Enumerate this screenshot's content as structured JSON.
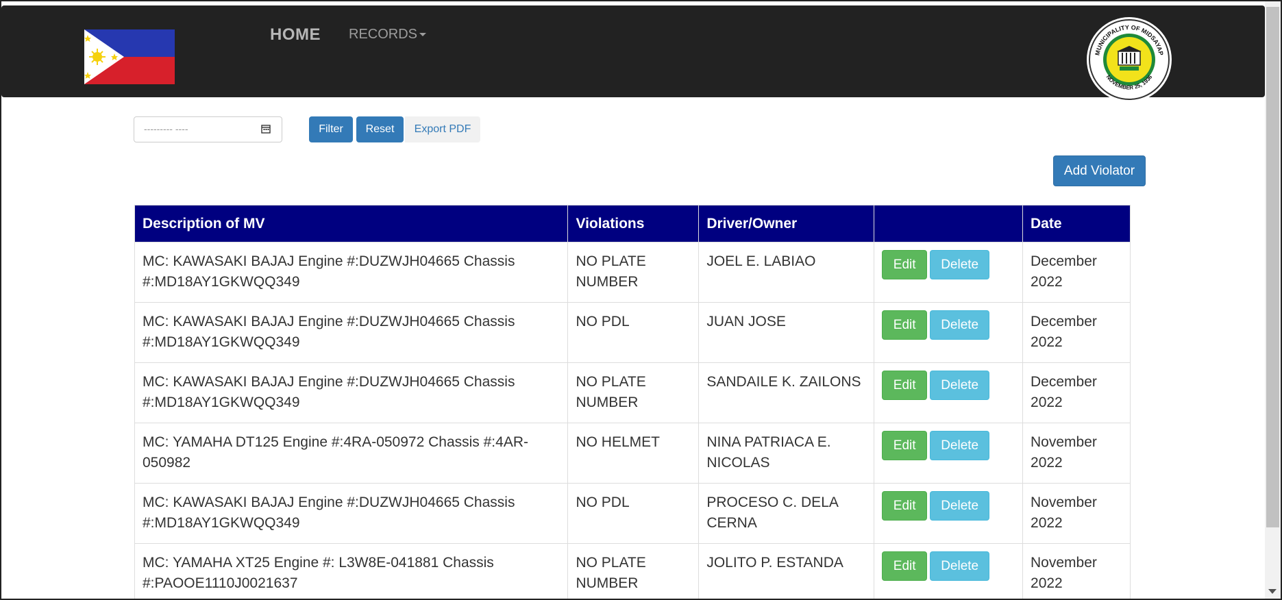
{
  "nav": {
    "home_label": "HOME",
    "records_label": "RECORDS"
  },
  "seal": {
    "text_top": "MUNICIPALITY OF MIDSAYAP",
    "text_bottom": "NOVEMBER 25, 1936"
  },
  "filter": {
    "date_placeholder": "--------- ----",
    "filter_label": "Filter",
    "reset_label": "Reset",
    "export_label": "Export PDF"
  },
  "add_button_label": "Add Violator",
  "table": {
    "headers": [
      "Description of MV",
      "Violations",
      "Driver/Owner",
      "",
      "Date"
    ],
    "edit_label": "Edit",
    "delete_label": "Delete",
    "rows": [
      {
        "description": "MC: KAWASAKI BAJAJ Engine #:DUZWJH04665 Chassis #:MD18AY1GKWQQ349",
        "violation": "NO PLATE NUMBER",
        "driver": "JOEL E. LABIAO",
        "date": "December 2022"
      },
      {
        "description": "MC: KAWASAKI BAJAJ Engine #:DUZWJH04665 Chassis #:MD18AY1GKWQQ349",
        "violation": "NO PDL",
        "driver": "JUAN JOSE",
        "date": "December 2022"
      },
      {
        "description": "MC: KAWASAKI BAJAJ Engine #:DUZWJH04665 Chassis #:MD18AY1GKWQQ349",
        "violation": "NO PLATE NUMBER",
        "driver": "SANDAILE K. ZAILONS",
        "date": "December 2022"
      },
      {
        "description": "MC: YAMAHA DT125 Engine #:4RA-050972 Chassis #:4AR-050982",
        "violation": "NO HELMET",
        "driver": "NINA PATRIACA E. NICOLAS",
        "date": "November 2022"
      },
      {
        "description": "MC: KAWASAKI BAJAJ Engine #:DUZWJH04665 Chassis #:MD18AY1GKWQQ349",
        "violation": "NO PDL",
        "driver": "PROCESO C. DELA CERNA",
        "date": "November 2022"
      },
      {
        "description": "MC: YAMAHA XT25 Engine #: L3W8E-041881 Chassis #:PAOOE1110J0021637",
        "violation": "NO PLATE NUMBER",
        "driver": "JOLITO P. ESTANDA",
        "date": "November 2022"
      }
    ]
  },
  "colors": {
    "navbar": "#222222",
    "table_header": "#000080",
    "primary": "#337ab7",
    "success": "#5cb85c",
    "info": "#5bc0de"
  }
}
